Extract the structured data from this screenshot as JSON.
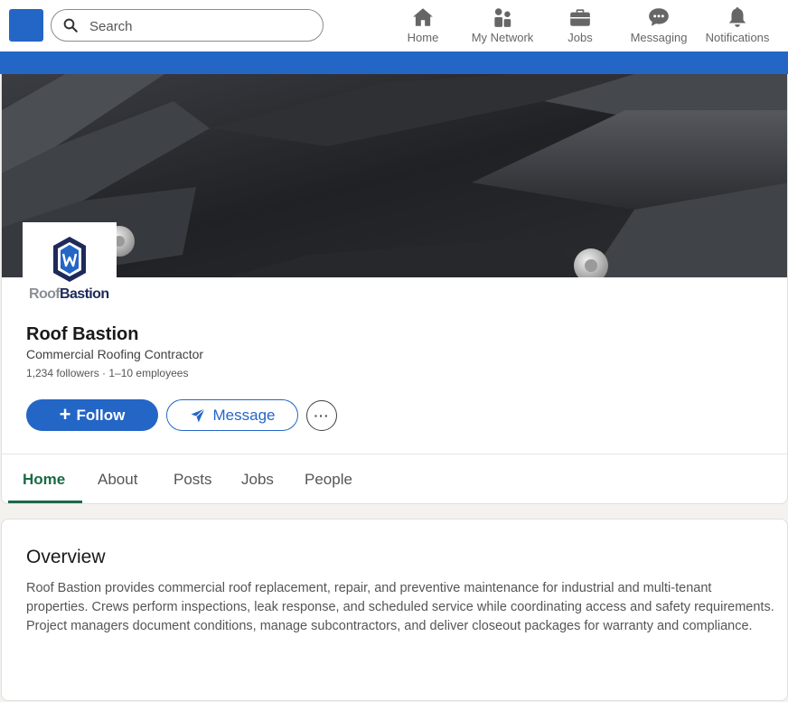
{
  "nav": {
    "search_placeholder": "Search",
    "items": [
      {
        "label": "Home",
        "icon": "home-icon"
      },
      {
        "label": "My Network",
        "icon": "network-icon"
      },
      {
        "label": "Jobs",
        "icon": "briefcase-icon"
      },
      {
        "label": "Messaging",
        "icon": "chat-icon"
      },
      {
        "label": "Notifications",
        "icon": "bell-icon"
      }
    ]
  },
  "company": {
    "logo": {
      "part1": "Roof",
      "part2": "Bastion"
    },
    "name": "Roof Bastion",
    "tagline": "Commercial Roofing Contractor",
    "meta": "1,234 followers · 1–10 employees"
  },
  "actions": {
    "follow_label": "Follow",
    "message_label": "Message",
    "more_label": "···"
  },
  "tabs": [
    {
      "label": "Home",
      "active": true
    },
    {
      "label": "About",
      "active": false
    },
    {
      "label": "Posts",
      "active": false
    },
    {
      "label": "Jobs",
      "active": false
    },
    {
      "label": "People",
      "active": false
    }
  ],
  "overview": {
    "title": "Overview",
    "body": "Roof Bastion provides commercial roof replacement, repair, and preventive maintenance for industrial and multi-tenant properties. Crews perform inspections, leak response, and scheduled service while coordinating access and safety requirements. Project managers document conditions, manage subcontractors, and deliver closeout packages for warranty and compliance."
  },
  "colors": {
    "brand_blue": "#2366c6",
    "active_tab": "#1b6a46"
  }
}
